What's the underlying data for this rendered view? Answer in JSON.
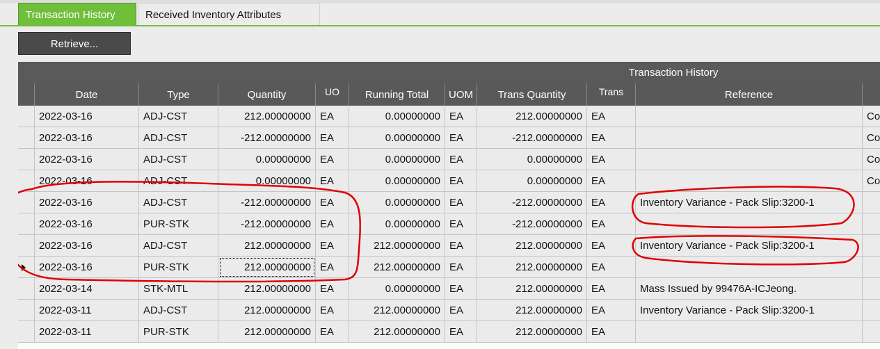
{
  "tabs": [
    "Transaction History",
    "Received Inventory Attributes"
  ],
  "toolbar": {
    "retrieve_label": "Retrieve..."
  },
  "grid": {
    "group_title": "Transaction History",
    "columns": [
      "Date",
      "Type",
      "Quantity",
      "UO",
      "Running Total",
      "UOM",
      "Trans Quantity",
      "Trans",
      "Reference",
      ""
    ],
    "rows": [
      {
        "date": "2022-03-16",
        "type": "ADJ-CST",
        "qty": "212.00000000",
        "uo": "EA",
        "running": "0.00000000",
        "uom": "EA",
        "tqty": "212.00000000",
        "trans": "EA",
        "ref": "",
        "extra": "Co"
      },
      {
        "date": "2022-03-16",
        "type": "ADJ-CST",
        "qty": "-212.00000000",
        "uo": "EA",
        "running": "0.00000000",
        "uom": "EA",
        "tqty": "-212.00000000",
        "trans": "EA",
        "ref": "",
        "extra": "Co"
      },
      {
        "date": "2022-03-16",
        "type": "ADJ-CST",
        "qty": "0.00000000",
        "uo": "EA",
        "running": "0.00000000",
        "uom": "EA",
        "tqty": "0.00000000",
        "trans": "EA",
        "ref": "",
        "extra": "Co"
      },
      {
        "date": "2022-03-16",
        "type": "ADJ-CST",
        "qty": "0.00000000",
        "uo": "EA",
        "running": "0.00000000",
        "uom": "EA",
        "tqty": "0.00000000",
        "trans": "EA",
        "ref": "",
        "extra": "Co"
      },
      {
        "date": "2022-03-16",
        "type": "ADJ-CST",
        "qty": "-212.00000000",
        "uo": "EA",
        "running": "0.00000000",
        "uom": "EA",
        "tqty": "-212.00000000",
        "trans": "EA",
        "ref": "Inventory Variance - Pack Slip:3200-1",
        "extra": ""
      },
      {
        "date": "2022-03-16",
        "type": "PUR-STK",
        "qty": "-212.00000000",
        "uo": "EA",
        "running": "0.00000000",
        "uom": "EA",
        "tqty": "-212.00000000",
        "trans": "EA",
        "ref": "",
        "extra": ""
      },
      {
        "date": "2022-03-16",
        "type": "ADJ-CST",
        "qty": "212.00000000",
        "uo": "EA",
        "running": "212.00000000",
        "uom": "EA",
        "tqty": "212.00000000",
        "trans": "EA",
        "ref": "Inventory Variance - Pack Slip:3200-1",
        "extra": ""
      },
      {
        "date": "2022-03-16",
        "type": "PUR-STK",
        "qty": "212.00000000",
        "uo": "EA",
        "running": "212.00000000",
        "uom": "EA",
        "tqty": "212.00000000",
        "trans": "EA",
        "ref": "",
        "extra": "",
        "selected": true
      },
      {
        "date": "2022-03-14",
        "type": "STK-MTL",
        "qty": "212.00000000",
        "uo": "EA",
        "running": "0.00000000",
        "uom": "EA",
        "tqty": "212.00000000",
        "trans": "EA",
        "ref": "Mass Issued by 99476A-ICJeong.",
        "extra": ""
      },
      {
        "date": "2022-03-11",
        "type": "ADJ-CST",
        "qty": "212.00000000",
        "uo": "EA",
        "running": "212.00000000",
        "uom": "EA",
        "tqty": "212.00000000",
        "trans": "EA",
        "ref": "Inventory Variance - Pack Slip:3200-1",
        "extra": ""
      },
      {
        "date": "2022-03-11",
        "type": "PUR-STK",
        "qty": "212.00000000",
        "uo": "EA",
        "running": "212.00000000",
        "uom": "EA",
        "tqty": "212.00000000",
        "trans": "EA",
        "ref": "",
        "extra": ""
      }
    ]
  },
  "colors": {
    "active_tab": "#6fbf3a",
    "header_bg": "#5a5a5a",
    "annotation": "#e00000"
  }
}
